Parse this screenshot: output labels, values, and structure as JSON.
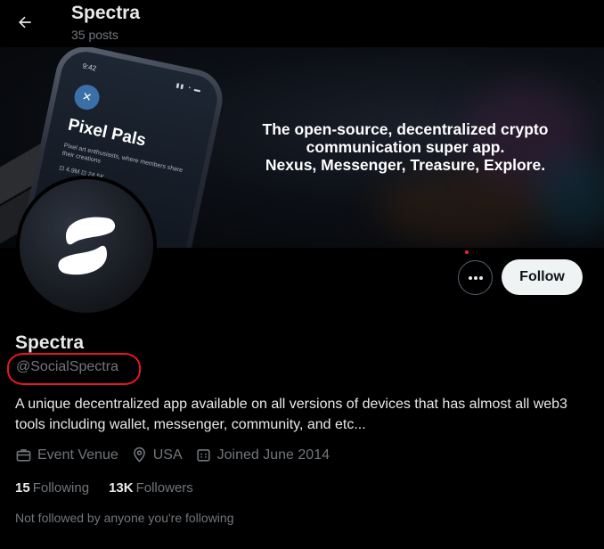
{
  "header": {
    "name": "Spectra",
    "posts": "35 posts"
  },
  "banner": {
    "line1": "The open-source, decentralized crypto",
    "line2": "communication super app.",
    "line3": "Nexus, Messenger, Treasure, Explore.",
    "phone": {
      "time": "9:42",
      "status": "▮▮ ◔ ▬",
      "title": "Pixel Pals",
      "subtitle": "Pixel art enthusiasts, where members share their creations",
      "stats": "⊡ 4.9M   ⊡ 24.5K"
    }
  },
  "actions": {
    "follow_label": "Follow"
  },
  "profile": {
    "display_name": "Spectra",
    "handle": "@SocialSpectra",
    "bio": "A unique decentralized app available on all versions of devices that has almost all web3 tools including wallet, messenger, community, and etc...",
    "category": "Event Venue",
    "location": "USA",
    "joined": "Joined June 2014",
    "following_count": "15",
    "following_label": "Following",
    "followers_count": "13K",
    "followers_label": "Followers",
    "not_followed_text": "Not followed by anyone you're following"
  },
  "colors": {
    "accent": "#eff3f4",
    "secondary_text": "#71767b",
    "annotation": "#e4181f"
  }
}
